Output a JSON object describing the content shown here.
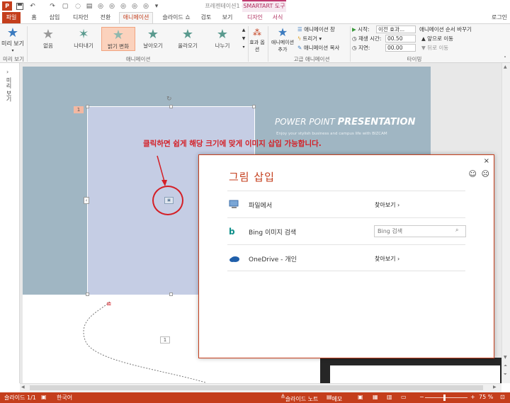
{
  "titlebar": {
    "doc_title": "프레젠테이션1 - PowerPoint",
    "smartart_tools": "SMARTART 도구",
    "login": "로그인"
  },
  "tabs": [
    "파일",
    "홈",
    "삽입",
    "디자인",
    "전환",
    "애니메이션",
    "슬라이드 쇼",
    "검토",
    "보기",
    "디자인",
    "서식"
  ],
  "ribbon": {
    "preview": {
      "label": "미리 보기",
      "group": "미리 보기"
    },
    "gallery": [
      {
        "label": "없음"
      },
      {
        "label": "나타내기"
      },
      {
        "label": "밝기 변화"
      },
      {
        "label": "날아오기"
      },
      {
        "label": "올라오기"
      },
      {
        "label": "나누기"
      }
    ],
    "group_animation": "애니메이션",
    "effect_options": "효과 옵션",
    "add_animation": "애니메이션 추가",
    "pane": "애니메이션 창",
    "trigger": "트리거",
    "painter": "애니메이션 복사",
    "group_advanced": "고급 애니메이션",
    "start_label": "시작:",
    "start_value": "이전 효과...",
    "duration_label": "재생 시간:",
    "duration_value": "00.50",
    "delay_label": "지연:",
    "delay_value": "00.00",
    "group_timing": "타이밍",
    "reorder_title": "애니메이션 순서 바꾸기",
    "move_earlier": "앞으로 이동",
    "move_later": "뒤로 이동"
  },
  "leftpane": {
    "vertical_label": "미리 보기"
  },
  "slide": {
    "title_light": "POWER POINT",
    "title_bold": "PRESENTATION",
    "subtitle": "Enjoy your stylish business and campus life with BIZCAM",
    "instruction": "클릭하면 쉽게 해당 크기에 맞게 이미지 삽입 가능합니다.",
    "badge1": "1",
    "badge2": "1"
  },
  "dialog": {
    "title": "그림 삽입",
    "rows": [
      {
        "name": "파일에서",
        "action": "찾아보기 ›"
      },
      {
        "name": "Bing 이미지 검색",
        "placeholder": "Bing 검색"
      },
      {
        "name": "OneDrive - 개인",
        "action": "찾아보기 ›"
      }
    ]
  },
  "statusbar": {
    "slide": "슬라이드 1/1",
    "lang": "한국어",
    "notes": "슬라이드 노트",
    "comments": "메모",
    "zoom": "75 %"
  },
  "colors": {
    "accent": "#c43e1c",
    "slide_bg": "#a0b6c3",
    "annotation": "#d41f26"
  }
}
